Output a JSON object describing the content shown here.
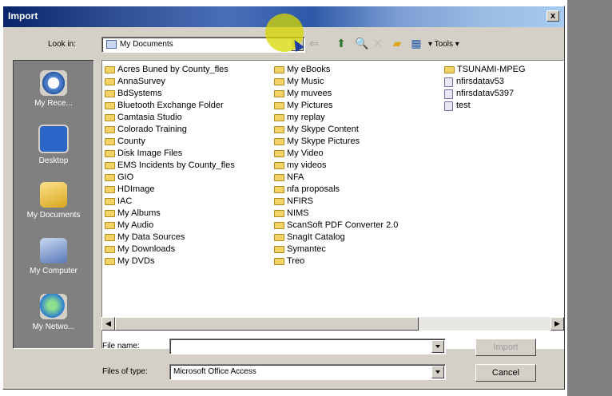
{
  "dialog": {
    "title": "Import",
    "close_glyph": "x",
    "look_in_label": "Look in:",
    "look_in_value": "My Documents",
    "tools_label": "Tools",
    "file_name_label": "File name:",
    "file_name_value": "",
    "files_of_type_label": "Files of type:",
    "files_of_type_value": "Microsoft Office Access",
    "import_button": "Import",
    "cancel_button": "Cancel"
  },
  "places": [
    {
      "label": "My Rece...",
      "icon": "recent-icon"
    },
    {
      "label": "Desktop",
      "icon": "desktop-icon"
    },
    {
      "label": "My Documents",
      "icon": "my-documents-icon"
    },
    {
      "label": "My Computer",
      "icon": "my-computer-icon"
    },
    {
      "label": "My Netwo...",
      "icon": "network-icon"
    }
  ],
  "files": {
    "col1": [
      "Acres Buned by County_fles",
      "AnnaSurvey",
      "BdSystems",
      "Bluetooth Exchange Folder",
      "Camtasia Studio",
      "Colorado Training",
      "County",
      "Disk Image Files",
      "EMS Incidents by County_fles",
      "GIO",
      "HDImage",
      "IAC",
      "My Albums",
      "My Audio",
      "My Data Sources",
      "My Downloads",
      "My DVDs"
    ],
    "col2": [
      "My eBooks",
      "My Music",
      "My muvees",
      "My Pictures",
      "my replay",
      "My Skype Content",
      "My Skype Pictures",
      "My Video",
      "my videos",
      "NFA",
      "nfa proposals",
      "NFIRS",
      "NIMS",
      "ScanSoft PDF Converter 2.0",
      "SnagIt Catalog",
      "Symantec",
      "Treo"
    ],
    "col3": [
      "TSUNAMI-MPEG",
      "nfirsdatav53",
      "nfirsdatav5397",
      "test"
    ]
  }
}
